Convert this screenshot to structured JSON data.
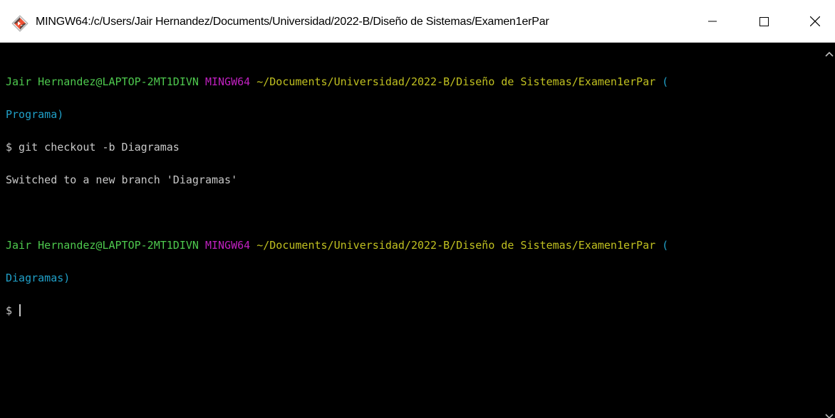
{
  "window": {
    "title": "MINGW64:/c/Users/Jair Hernandez/Documents/Universidad/2022-B/Diseño de Sistemas/Examen1erPar",
    "app_icon": "git-bash-icon",
    "controls": {
      "minimize": "minimize-icon",
      "maximize": "maximize-icon",
      "close": "close-icon"
    }
  },
  "terminal": {
    "prompt1": {
      "user_host": "Jair Hernandez@LAPTOP-2MT1DIVN",
      "system": "MINGW64",
      "path": "~/Documents/Universidad/2022-B/Diseño de Sistemas/Examen1erPar",
      "branch_open": "(",
      "branch": "Programa)"
    },
    "command1": "$ git checkout -b Diagramas",
    "output1": "Switched to a new branch 'Diagramas'",
    "prompt2": {
      "user_host": "Jair Hernandez@LAPTOP-2MT1DIVN",
      "system": "MINGW64",
      "path": "~/Documents/Universidad/2022-B/Diseño de Sistemas/Examen1erPar",
      "branch_open": "(",
      "branch": "Diagramas)"
    },
    "current_prompt": "$ "
  },
  "colors": {
    "background": "#000000",
    "user_host": "#4ec94e",
    "system": "#c020c0",
    "path": "#c0c020",
    "branch": "#20a0c8",
    "text": "#c8c8c8"
  }
}
